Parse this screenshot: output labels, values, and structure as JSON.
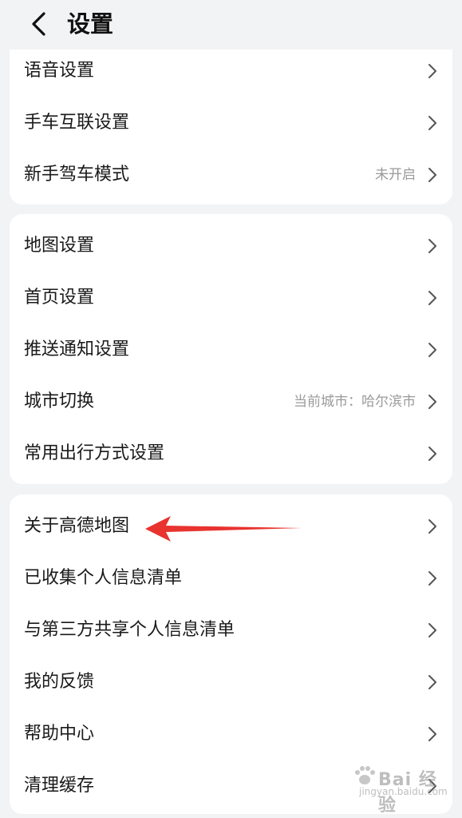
{
  "header": {
    "title": "设置",
    "back_icon": "chevron-left-icon"
  },
  "groups": [
    {
      "items": [
        {
          "label": "语音设置",
          "value": ""
        },
        {
          "label": "手车互联设置",
          "value": ""
        },
        {
          "label": "新手驾车模式",
          "value": "未开启"
        }
      ]
    },
    {
      "items": [
        {
          "label": "地图设置",
          "value": ""
        },
        {
          "label": "首页设置",
          "value": ""
        },
        {
          "label": "推送通知设置",
          "value": ""
        },
        {
          "label": "城市切换",
          "value": "当前城市：哈尔滨市"
        },
        {
          "label": "常用出行方式设置",
          "value": ""
        }
      ]
    },
    {
      "items": [
        {
          "label": "关于高德地图",
          "value": ""
        },
        {
          "label": "已收集个人信息清单",
          "value": ""
        },
        {
          "label": "与第三方共享个人信息清单",
          "value": ""
        },
        {
          "label": "我的反馈",
          "value": ""
        },
        {
          "label": "帮助中心",
          "value": ""
        },
        {
          "label": "清理缓存",
          "value": ""
        }
      ]
    }
  ],
  "annotation": {
    "arrow_color": "#e8332f"
  },
  "watermark": {
    "text": "Bai 经验",
    "sub": "jingyan.baidu.com"
  },
  "colors": {
    "background": "#f2f3f5",
    "card": "#ffffff",
    "secondary_text": "#9a9a9a"
  }
}
